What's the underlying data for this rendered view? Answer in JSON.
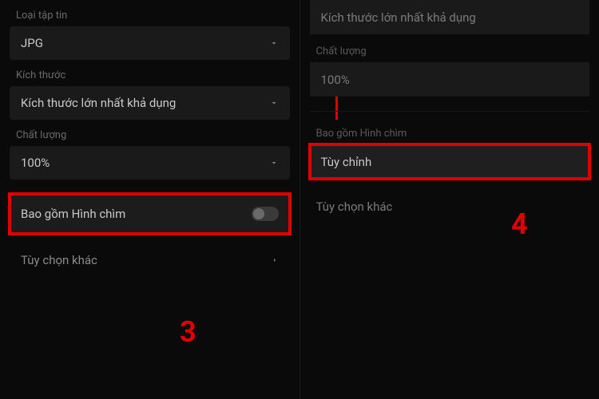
{
  "left": {
    "fileTypeLabel": "Loại tập tin",
    "fileTypeValue": "JPG",
    "sizeLabel": "Kích thước",
    "sizeValue": "Kích thước lớn nhất khả dụng",
    "qualityLabel": "Chất lượng",
    "qualityValue": "100%",
    "watermarkLabel": "Bao gồm Hình chìm",
    "otherOptionsLabel": "Tùy chọn khác"
  },
  "right": {
    "sizeValue": "Kích thước lớn nhất khả dụng",
    "qualityLabel": "Chất lượng",
    "qualityValue": "100%",
    "watermarkSectionLabel": "Bao gồm Hình chìm",
    "customizeLabel": "Tùy chỉnh",
    "otherOptionsLabel": "Tùy chọn khác"
  },
  "annotations": {
    "step3": "3",
    "step4": "4"
  },
  "colors": {
    "highlight": "#e00000"
  }
}
